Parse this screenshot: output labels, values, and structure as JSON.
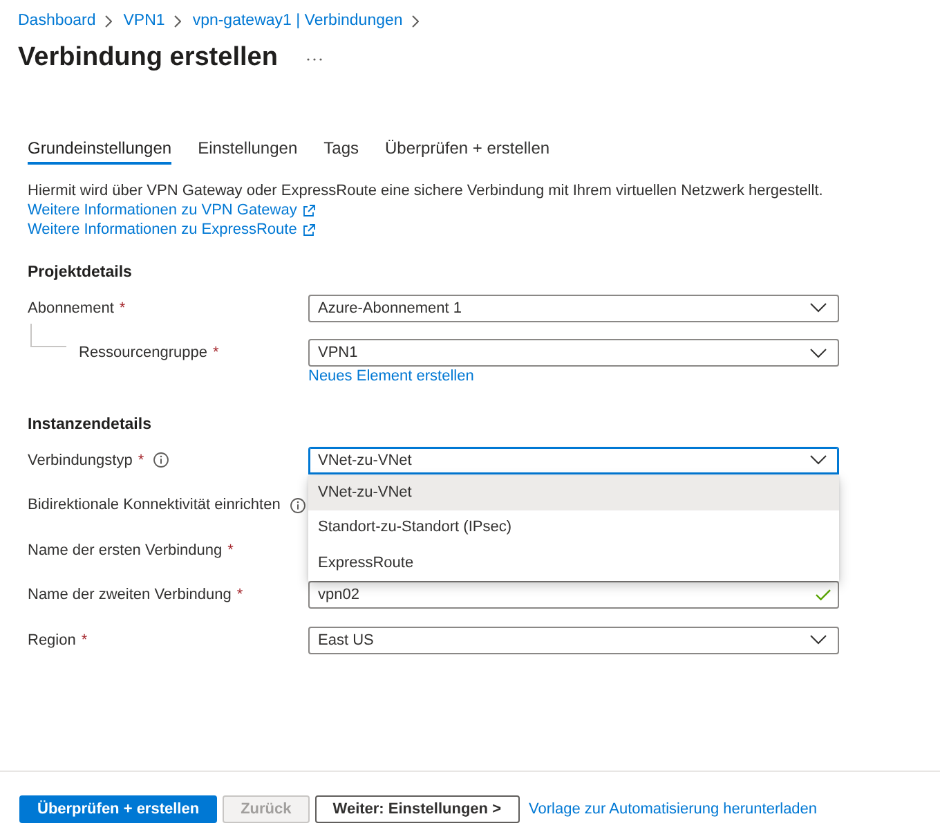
{
  "breadcrumb": [
    "Dashboard",
    "VPN1",
    "vpn-gateway1 | Verbindungen"
  ],
  "title": "Verbindung erstellen",
  "tabs": [
    {
      "label": "Grundeinstellungen",
      "selected": true
    },
    {
      "label": "Einstellungen",
      "selected": false
    },
    {
      "label": "Tags",
      "selected": false
    },
    {
      "label": "Überprüfen + erstellen",
      "selected": false
    }
  ],
  "intro": {
    "text": "Hiermit wird über VPN Gateway oder ExpressRoute eine sichere Verbindung mit Ihrem virtuellen Netzwerk hergestellt.",
    "links": [
      "Weitere Informationen zu VPN Gateway",
      "Weitere Informationen zu ExpressRoute"
    ]
  },
  "sections": [
    {
      "heading": "Projektdetails",
      "fields": [
        {
          "label": "Abonnement",
          "required_mark": "*",
          "info": false,
          "kind": "select",
          "value": "Azure-Abonnement 1",
          "focused": false,
          "expanded": false,
          "children": [
            {
              "label": "Ressourcengruppe",
              "required_mark": "*",
              "info": false,
              "kind": "select",
              "value": "VPN1",
              "focused": false,
              "expanded": false,
              "link": "Neues Element erstellen"
            }
          ]
        }
      ]
    },
    {
      "heading": "Instanzendetails",
      "fields": [
        {
          "label": "Verbindungstyp",
          "required_mark": "*",
          "info": true,
          "kind": "select",
          "value": "VNet-zu-VNet",
          "focused": true,
          "expanded": true,
          "options": [
            {
              "label": "VNet-zu-VNet",
              "selected": true
            },
            {
              "label": "Standort-zu-Standort (IPsec)",
              "selected": false
            },
            {
              "label": "ExpressRoute",
              "selected": false
            }
          ]
        },
        {
          "label": "Bidirektionale Konnektivität einrichten",
          "info": true,
          "kind": "covered"
        },
        {
          "label": "Name der ersten Verbindung",
          "required_mark": "*",
          "info": false,
          "kind": "covered"
        },
        {
          "label": "Name der zweiten Verbindung",
          "required_mark": "*",
          "info": false,
          "kind": "text",
          "value": "vpn02",
          "valid": true
        },
        {
          "label": "Region",
          "required_mark": "*",
          "info": false,
          "kind": "select",
          "value": "East US",
          "focused": false,
          "expanded": false
        }
      ]
    }
  ],
  "footer": {
    "buttons": [
      {
        "label": "Überprüfen + erstellen",
        "kind": "primary",
        "disabled": false
      },
      {
        "label": "Zurück",
        "kind": "secondary",
        "disabled": true
      },
      {
        "label": "Weiter: Einstellungen >",
        "kind": "secondary",
        "disabled": false
      }
    ],
    "link": "Vorlage zur Automatisierung herunterladen"
  }
}
